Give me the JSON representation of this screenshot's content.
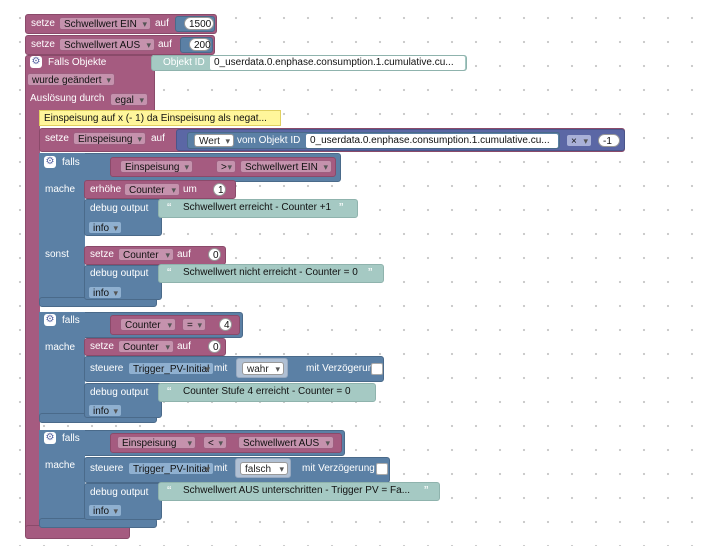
{
  "set1": {
    "kw": "setze",
    "var": "Schwellwert EIN",
    "auf": "auf",
    "val": "1500"
  },
  "set2": {
    "kw": "setze",
    "var": "Schwellwert AUS",
    "auf": "auf",
    "val": "200"
  },
  "trig": {
    "title": "Falls Objekte",
    "oid_label": "Objekt ID",
    "oid": "0_userdata.0.enphase.consumption.1.cumulative.cu...",
    "changed": "wurde geändert",
    "ausloesung": "Auslösung durch",
    "ausl_val": "egal"
  },
  "comment": "Einspeisung auf x (- 1) da Einspeisung als negat...",
  "set3": {
    "kw": "setze",
    "var": "Einspeisung",
    "auf": "auf",
    "wert": "Wert",
    "vom": "vom Objekt ID",
    "oid": "0_userdata.0.enphase.consumption.1.cumulative.cu...",
    "op": "×",
    "num": "-1"
  },
  "if1": {
    "falls": "falls",
    "mache": "mache",
    "sonst": "sonst",
    "a": "Einspeisung",
    "op": ">",
    "b": "Schwellwert EIN",
    "inc_kw": "erhöhe",
    "inc_var": "Counter",
    "um": "um",
    "inc_val": "1",
    "dbg": "debug output",
    "msg1": "Schwellwert erreicht - Counter +1",
    "lvl": "info",
    "set_kw": "setze",
    "set_var": "Counter",
    "auf": "auf",
    "set_val": "0",
    "msg2": "Schwellwert nicht erreicht - Counter = 0"
  },
  "if2": {
    "falls": "falls",
    "mache": "mache",
    "a": "Counter",
    "op": "=",
    "b": "4",
    "set_kw": "setze",
    "set_var": "Counter",
    "auf": "auf",
    "set_val": "0",
    "steuere": "steuere",
    "obj": "Trigger_PV-Initial",
    "mit": "mit",
    "bool": "wahr",
    "delay": "mit Verzögerung",
    "dbg": "debug output",
    "msg": "Counter Stufe 4 erreicht - Counter = 0",
    "lvl": "info"
  },
  "if3": {
    "falls": "falls",
    "mache": "mache",
    "a": "Einspeisung",
    "op": "<",
    "b": "Schwellwert AUS",
    "steuere": "steuere",
    "obj": "Trigger_PV-Initial",
    "mit": "mit",
    "bool": "falsch",
    "delay": "mit Verzögerung",
    "dbg": "debug output",
    "msg": "Schwellwert AUS unterschritten - Trigger PV = Fa...",
    "lvl": "info"
  },
  "quote_open": "“",
  "quote_close": "”"
}
